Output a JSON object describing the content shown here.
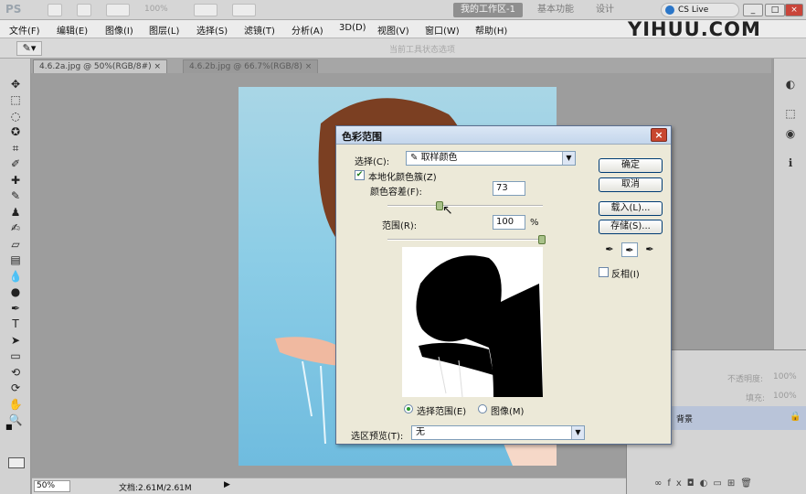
{
  "app": {
    "logo": "PS",
    "zoom": "100%",
    "workspaces": [
      "我的工作区-1",
      "基本功能",
      "设计"
    ],
    "cs_live": "CS Live"
  },
  "menu": [
    "文件(F)",
    "编辑(E)",
    "图像(I)",
    "图层(L)",
    "选择(S)",
    "滤镜(T)",
    "分析(A)",
    "3D(D)",
    "视图(V)",
    "窗口(W)",
    "帮助(H)"
  ],
  "brand": "YIHUU.COM",
  "options_bar": {
    "tip": "当前工具状态选项"
  },
  "tabs": [
    {
      "label": "4.6.2a.jpg @ 50%(RGB/8#)"
    },
    {
      "label": "4.6.2b.jpg @ 66.7%(RGB/8)"
    }
  ],
  "status": {
    "zoom": "50%",
    "doc": "文档:2.61M/2.61M"
  },
  "dialog": {
    "title": "色彩范围",
    "select_label": "选择(C):",
    "select_value": "取样颜色",
    "localized_label": "本地化颜色簇(Z)",
    "localized_checked": true,
    "fuzziness_label": "颜色容差(F):",
    "fuzziness_value": "73",
    "fuzziness_level": 0.34,
    "range_label": "范围(R):",
    "range_value": "100",
    "range_unit": "%",
    "range_level": 1.0,
    "radio_selection": "选择范围(E)",
    "radio_image": "图像(M)",
    "preview_label": "选区预览(T):",
    "preview_value": "无",
    "buttons": {
      "ok": "确定",
      "cancel": "取消",
      "load": "载入(L)...",
      "save": "存储(S)..."
    },
    "invert_label": "反相(I)"
  },
  "layers_panel": {
    "opacity_label": "不透明度:",
    "opacity": "100%",
    "fill_label": "填充:",
    "fill": "100%",
    "layer_name": "背景"
  }
}
